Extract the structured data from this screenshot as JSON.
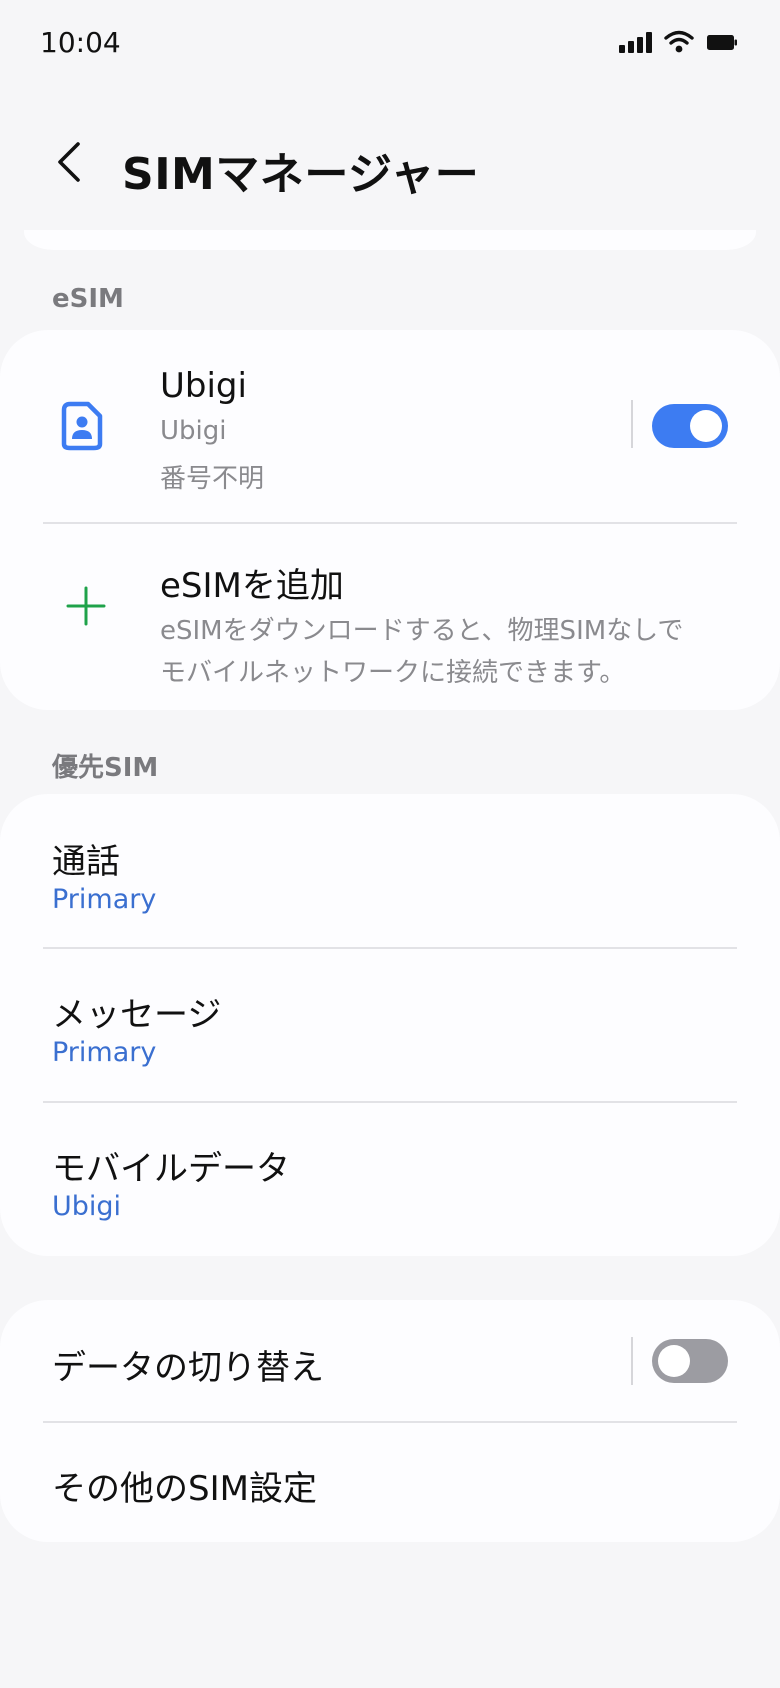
{
  "status_bar": {
    "time": "10:04",
    "icons": [
      "signal-icon",
      "wifi-icon",
      "battery-icon"
    ]
  },
  "header": {
    "title": "SIMマネージャー",
    "back_icon": "back-arrow-icon"
  },
  "esim_section": {
    "label": "eSIM",
    "sim": {
      "name": "Ubigi",
      "carrier": "Ubigi",
      "number": "番号不明",
      "enabled": true,
      "icon": "sim-card-icon"
    },
    "add": {
      "title": "eSIMを追加",
      "description_line1": "eSIMをダウンロードすると、物理SIMなしで",
      "description_line2": "モバイルネットワークに接続できます。",
      "icon": "plus-icon"
    }
  },
  "preferred_section": {
    "label": "優先SIM",
    "items": [
      {
        "title": "通話",
        "value": "Primary"
      },
      {
        "title": "メッセージ",
        "value": "Primary"
      },
      {
        "title": "モバイルデータ",
        "value": "Ubigi"
      }
    ]
  },
  "other_section": {
    "data_switch": {
      "title": "データの切り替え",
      "enabled": false
    },
    "more_settings": {
      "title": "その他のSIM設定"
    }
  },
  "colors": {
    "accent": "#3d7cf2",
    "value_text": "#3a6fd0",
    "add_icon": "#1fa24a",
    "background": "#f6f6f8",
    "card": "#fdfdff"
  }
}
